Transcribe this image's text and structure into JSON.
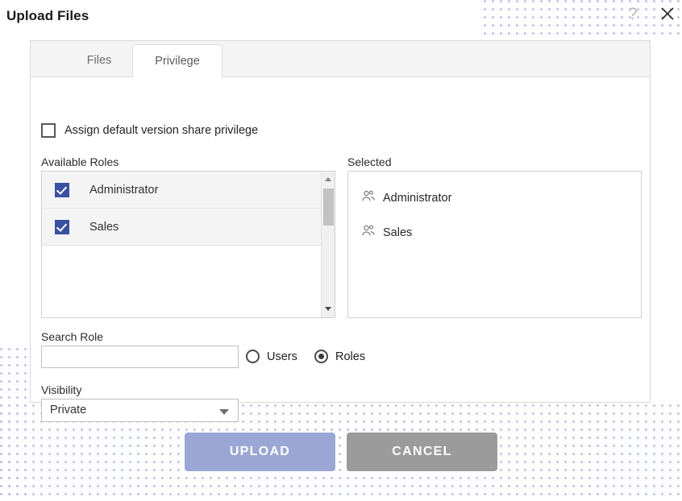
{
  "dialog": {
    "title": "Upload Files",
    "help_icon": "?",
    "close_icon": "close-x"
  },
  "tabs": [
    {
      "id": "files",
      "label": "Files",
      "active": false
    },
    {
      "id": "privilege",
      "label": "Privilege",
      "active": true
    }
  ],
  "assign_default": {
    "label": "Assign default version share privilege",
    "checked": false
  },
  "available_roles": {
    "label": "Available Roles",
    "items": [
      {
        "name": "Administrator",
        "checked": true
      },
      {
        "name": "Sales",
        "checked": true
      }
    ]
  },
  "selected": {
    "label": "Selected",
    "items": [
      {
        "name": "Administrator",
        "icon": "group-icon"
      },
      {
        "name": "Sales",
        "icon": "group-icon"
      }
    ]
  },
  "search": {
    "label": "Search Role",
    "value": "",
    "placeholder": "",
    "scope_options": [
      {
        "id": "users",
        "label": "Users",
        "selected": false
      },
      {
        "id": "roles",
        "label": "Roles",
        "selected": true
      }
    ]
  },
  "visibility": {
    "label": "Visibility",
    "value": "Private",
    "caret_icon": "chevron-down-icon"
  },
  "actions": {
    "upload_label": "UPLOAD",
    "cancel_label": "CANCEL"
  },
  "colors": {
    "checkbox_blue": "#3a50a2",
    "upload_button": "#9aa7d4",
    "cancel_button": "#9b9b9b",
    "dot_pattern": "#a8b3e0",
    "tab_strip": "#f4f4f4"
  }
}
